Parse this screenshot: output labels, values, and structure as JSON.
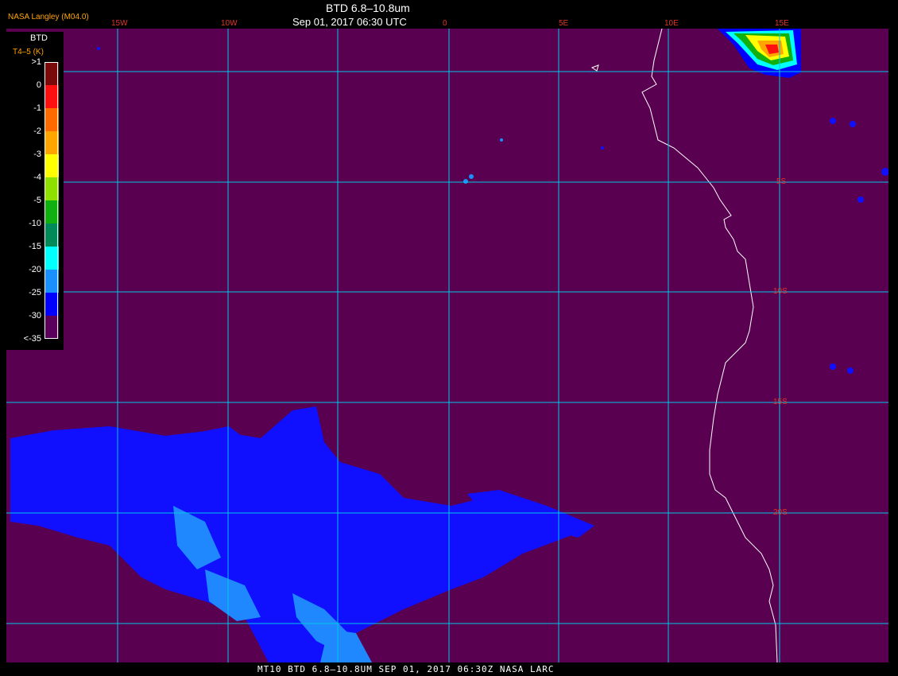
{
  "header": {
    "credit": "NASA Langley (M04.0)",
    "title": "BTD 6.8–10.8um",
    "subtitle": "Sep 01, 2017 06:30 UTC"
  },
  "legend": {
    "title": "BTD",
    "units": "T4–5 (K)",
    "ticks": [
      ">1",
      "0",
      "-1",
      "-2",
      "-3",
      "-4",
      "-5",
      "-10",
      "-15",
      "-20",
      "-25",
      "-30",
      "<-35"
    ],
    "colors": [
      "#7a0a0a",
      "#ff1010",
      "#ff6a00",
      "#ffa500",
      "#ffff00",
      "#8ee000",
      "#10b010",
      "#008a5a",
      "#00ffff",
      "#1a90ff",
      "#0000ff",
      "#5a005a"
    ]
  },
  "map": {
    "background_color": "#5a0050",
    "grid_color": "#00c8e6",
    "coast_color": "#ffffff",
    "lon_labels": [
      "15W",
      "10W",
      "0",
      "5E",
      "10E",
      "15E"
    ],
    "lat_labels": [
      "5S",
      "10S",
      "15S",
      "20S"
    ]
  },
  "footer": {
    "text": "MT10  BTD 6.8–10.8UM  SEP 01, 2017 06:30Z  NASA LARC"
  }
}
